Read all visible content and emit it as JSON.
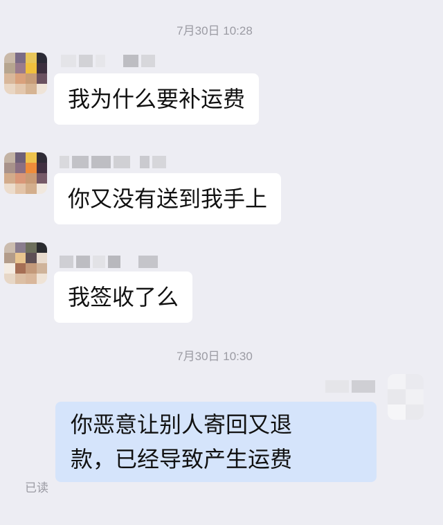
{
  "conversation": {
    "timestamp_1": "7月30日 10:28",
    "timestamp_2": "7月30日 10:30",
    "messages": [
      {
        "direction": "incoming",
        "text": "我为什么要补运费"
      },
      {
        "direction": "incoming",
        "text": "你又没有送到我手上"
      },
      {
        "direction": "incoming",
        "text": "我签收了么"
      },
      {
        "direction": "outgoing",
        "line1": "你恶意让别人寄回又退",
        "line2": "款，已经导致产生运费"
      }
    ],
    "read_status": "已读"
  },
  "colors": {
    "background": "#ededf3",
    "incoming_bubble": "#ffffff",
    "outgoing_bubble": "#d5e4fb",
    "timestamp_text": "#9b9ba3"
  }
}
